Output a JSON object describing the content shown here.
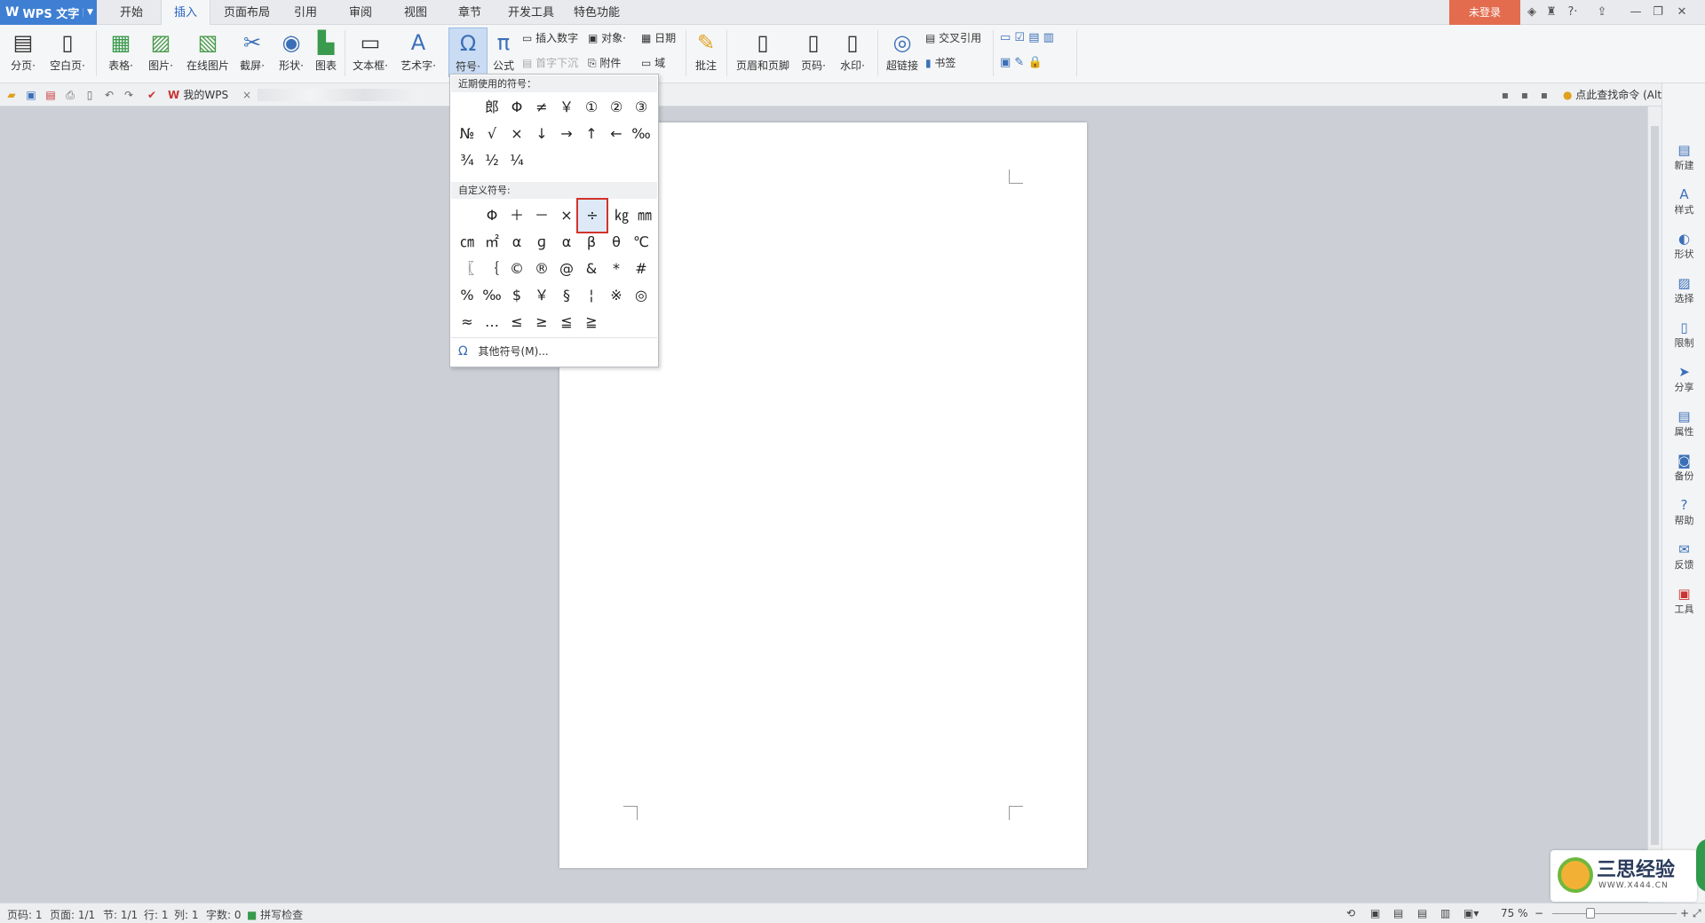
{
  "app": {
    "logo": "WPS 文字",
    "logo_mark": "W"
  },
  "menu_tabs": [
    "开始",
    "插入",
    "页面布局",
    "引用",
    "审阅",
    "视图",
    "章节",
    "开发工具",
    "特色功能"
  ],
  "active_tab": "插入",
  "login_label": "未登录",
  "title_icons": {
    "help": "?·"
  },
  "ribbon": {
    "buttons": [
      {
        "label": "分页·",
        "icon": "page-break-icon"
      },
      {
        "label": "空白页·",
        "icon": "blank-page-icon"
      },
      {
        "label": "表格·",
        "icon": "table-icon"
      },
      {
        "label": "图片·",
        "icon": "picture-icon"
      },
      {
        "label": "在线图片",
        "icon": "online-picture-icon"
      },
      {
        "label": "截屏·",
        "icon": "screenshot-icon"
      },
      {
        "label": "形状·",
        "icon": "shape-icon"
      },
      {
        "label": "图表",
        "icon": "chart-icon"
      },
      {
        "label": "文本框·",
        "icon": "textbox-icon"
      },
      {
        "label": "艺术字·",
        "icon": "wordart-icon"
      },
      {
        "label": "符号·",
        "icon": "omega-icon"
      },
      {
        "label": "公式",
        "icon": "pi-icon"
      },
      {
        "label": "批注",
        "icon": "comment-icon"
      },
      {
        "label": "页眉和页脚",
        "icon": "header-footer-icon"
      },
      {
        "label": "页码·",
        "icon": "page-number-icon"
      },
      {
        "label": "水印·",
        "icon": "watermark-icon"
      },
      {
        "label": "超链接",
        "icon": "hyperlink-icon"
      }
    ],
    "small": {
      "insert_number": "插入数字",
      "object": "对象·",
      "date": "日期",
      "drop_cap": "首字下沉",
      "attachment": "附件",
      "field": "域",
      "cross_ref": "交叉引用",
      "bookmark": "书签"
    }
  },
  "toolbar2": {
    "doc_tab": "我的WPS",
    "find_command": "点此查找命令 (Alt+Q)"
  },
  "symbol_menu": {
    "recent_title": "近期使用的符号：",
    "recent": [
      "郎",
      "Φ",
      "≠",
      "￥",
      "①",
      "②",
      "③",
      "№",
      "√",
      "×",
      "↓",
      "→",
      "↑",
      "←",
      "‰",
      "¾",
      "½",
      "¼"
    ],
    "custom_title": "自定义符号:",
    "custom_row1": [
      "Φ",
      "＋",
      "－",
      "×",
      "÷",
      "㎏",
      "㎜"
    ],
    "custom_rows": [
      [
        "㎝",
        "㎡",
        "α",
        "ɡ",
        "α",
        "β",
        "θ",
        "℃"
      ],
      [
        "〖",
        "｛",
        "©",
        "®",
        "@",
        "&",
        "*",
        "#"
      ],
      [
        "%",
        "‰",
        "$",
        "￥",
        "§",
        "¦",
        "※",
        "◎"
      ],
      [
        "≈",
        "…",
        "≤",
        "≥",
        "≦",
        "≧"
      ]
    ],
    "selected": "÷",
    "more_label": "其他符号(M)...",
    "more_icon": "Ω"
  },
  "side_panel": [
    "新建",
    "样式",
    "形状",
    "选择",
    "限制",
    "分享",
    "属性",
    "备份",
    "帮助",
    "反馈",
    "工具"
  ],
  "status": {
    "page_no": "页码: 1",
    "pages": "页面: 1/1",
    "section": "节: 1/1",
    "row": "行: 1",
    "col": "列: 1",
    "words": "字数: 0",
    "spell": "拼写检查",
    "zoom": "75 %"
  },
  "watermark": {
    "title": "三思经验",
    "url": "WWW.X444.CN"
  },
  "colors": {
    "accent": "#3e7fd3",
    "login": "#e36c4f",
    "highlight": "#d2332b"
  }
}
